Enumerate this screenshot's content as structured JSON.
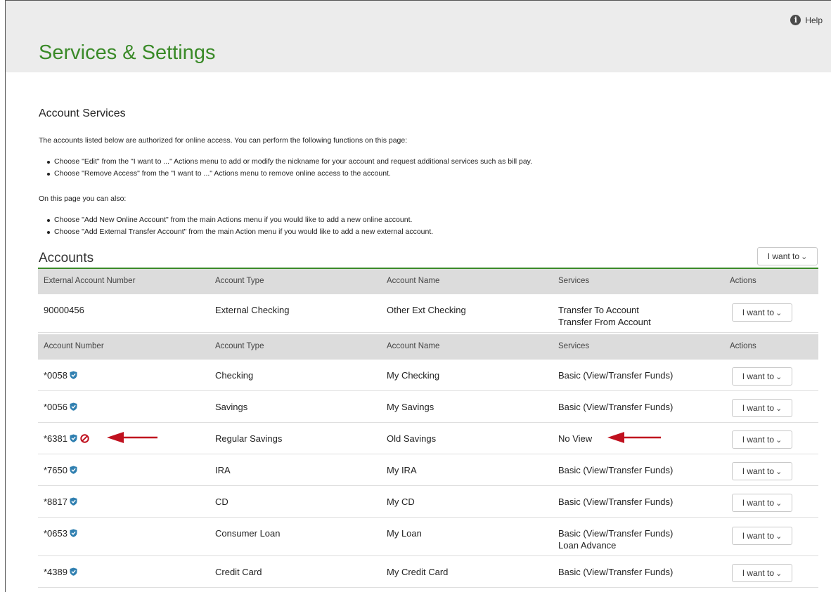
{
  "header": {
    "help_label": "Help",
    "title": "Services & Settings"
  },
  "intro": {
    "section_title": "Account Services",
    "para1": "The accounts listed below are authorized for online access. You can perform the following functions on this page:",
    "bullets1": [
      "Choose \"Edit\" from the \"I want to ...\" Actions menu to add or modify the nickname for your account and request additional services such as bill pay.",
      "Choose \"Remove Access\" from the \"I want to ...\" Actions menu to remove online access to the account."
    ],
    "para2": "On this page you can also:",
    "bullets2": [
      "Choose \"Add New Online Account\" from the main Actions menu if you would like to add a new online account.",
      "Choose \"Add External Transfer Account\" from the main Action menu if you would like to add a new external account."
    ]
  },
  "accounts": {
    "title": "Accounts",
    "main_action_label": "I want to",
    "external_headers": [
      "External Account Number",
      "Account Type",
      "Account Name",
      "Services",
      "Actions"
    ],
    "external_rows": [
      {
        "number": "90000456",
        "type": "External Checking",
        "name": "Other Ext Checking",
        "services": [
          "Transfer To Account",
          "Transfer From Account"
        ],
        "action": "I want to"
      }
    ],
    "headers": [
      "Account Number",
      "Account Type",
      "Account Name",
      "Services",
      "Actions"
    ],
    "rows": [
      {
        "number": "*0058",
        "type": "Checking",
        "name": "My Checking",
        "services": [
          "Basic (View/Transfer Funds)"
        ],
        "action": "I want to",
        "icons": [
          "shield-icon"
        ]
      },
      {
        "number": "*0056",
        "type": "Savings",
        "name": "My Savings",
        "services": [
          "Basic (View/Transfer Funds)"
        ],
        "action": "I want to",
        "icons": [
          "shield-icon"
        ]
      },
      {
        "number": "*6381",
        "type": "Regular Savings",
        "name": "Old Savings",
        "services": [
          "No View"
        ],
        "action": "I want to",
        "icons": [
          "shield-icon",
          "no-view-icon"
        ]
      },
      {
        "number": "*7650",
        "type": "IRA",
        "name": "My IRA",
        "services": [
          "Basic (View/Transfer Funds)"
        ],
        "action": "I want to",
        "icons": [
          "shield-icon"
        ]
      },
      {
        "number": "*8817",
        "type": "CD",
        "name": "My CD",
        "services": [
          "Basic (View/Transfer Funds)"
        ],
        "action": "I want to",
        "icons": [
          "shield-icon"
        ]
      },
      {
        "number": "*0653",
        "type": "Consumer Loan",
        "name": "My Loan",
        "services": [
          "Basic (View/Transfer Funds)",
          "Loan Advance"
        ],
        "action": "I want to",
        "icons": [
          "shield-icon"
        ]
      },
      {
        "number": "*4389",
        "type": "Credit Card",
        "name": "My Credit Card",
        "services": [
          "Basic (View/Transfer Funds)"
        ],
        "action": "I want to",
        "icons": [
          "shield-icon"
        ]
      }
    ]
  },
  "colors": {
    "title_green": "#3a8a28",
    "rule_green": "#3a8a28",
    "header_bg": "#ececec",
    "table_header_bg": "#dcdcdc",
    "shield_blue": "#2f7fb0",
    "annotation_red": "#c0111f"
  }
}
